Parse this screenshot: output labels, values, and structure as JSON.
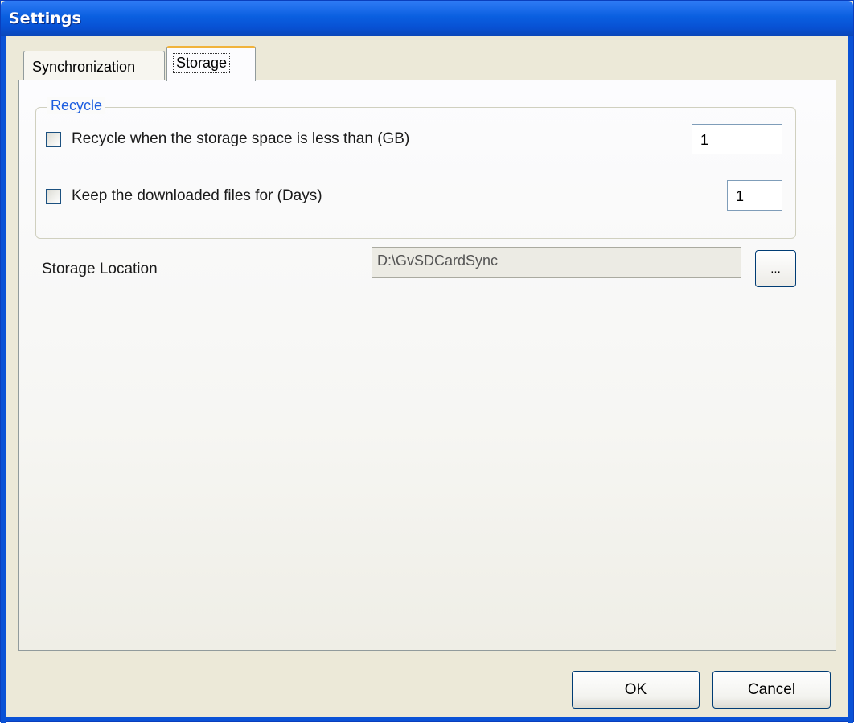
{
  "window": {
    "title": "Settings"
  },
  "tabs": [
    {
      "label": "Synchronization",
      "selected": false
    },
    {
      "label": "Storage",
      "selected": true
    }
  ],
  "recycle_group": {
    "legend": "Recycle",
    "option_space": {
      "label": "Recycle when the storage space is less than (GB)",
      "checked": false,
      "value": "1"
    },
    "option_days": {
      "label": "Keep the downloaded files for (Days)",
      "checked": false,
      "value": "1"
    }
  },
  "storage": {
    "label": "Storage Location",
    "path": "D:\\GvSDCardSync",
    "browse_label": "..."
  },
  "footer": {
    "ok_label": "OK",
    "cancel_label": "Cancel"
  },
  "colors": {
    "title_bar": "#0a5fe0",
    "group_legend": "#1d5ee0",
    "selected_tab_accent": "#f1b33b",
    "dialog_face": "#ece9d8"
  }
}
